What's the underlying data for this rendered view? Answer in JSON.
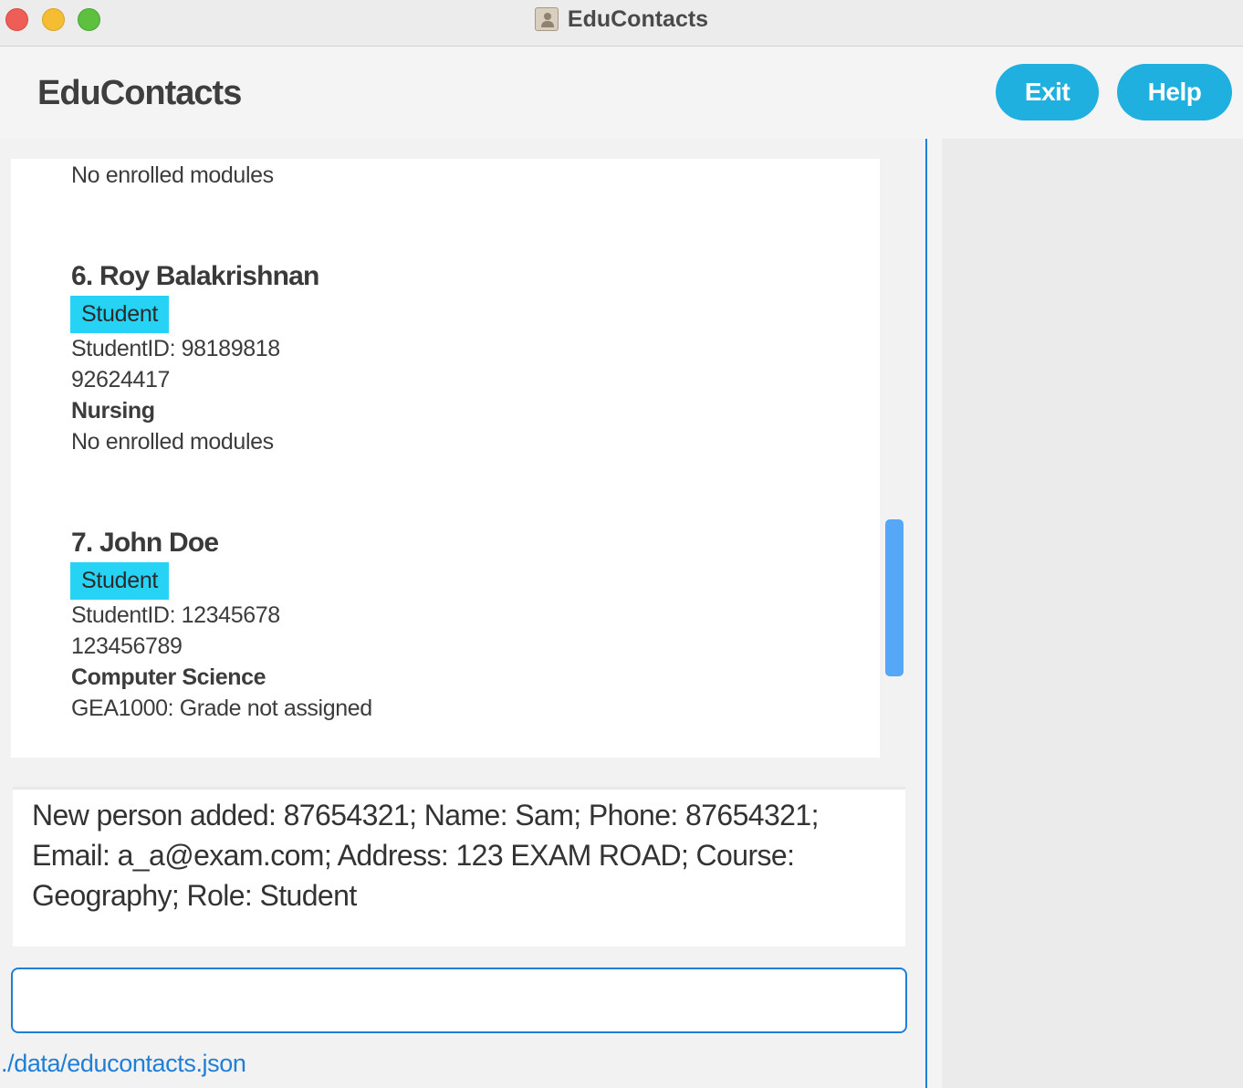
{
  "window": {
    "title": "EduContacts",
    "app_icon": "contacts-book-icon"
  },
  "header": {
    "title": "EduContacts",
    "exit_label": "Exit",
    "help_label": "Help",
    "accent_color": "#1fb0df"
  },
  "person_list": {
    "partial_top": {
      "modules": "No enrolled modules"
    },
    "people": [
      {
        "name": "6. Roy Balakrishnan",
        "role": "Student",
        "student_id": "StudentID: 98189818",
        "phone": "92624417",
        "course": "Nursing",
        "modules": "No enrolled modules"
      },
      {
        "name": "7. John Doe",
        "role": "Student",
        "student_id": "StudentID: 12345678",
        "phone": "123456789",
        "course": "Computer Science",
        "modules": "GEA1000: Grade not assigned"
      }
    ]
  },
  "result_display": {
    "text": "New person added: 87654321; Name: Sam; Phone: 87654321; Email: a_a@exam.com; Address: 123 EXAM ROAD; Course: Geography; Role: Student"
  },
  "command_box": {
    "value": ""
  },
  "status_bar": {
    "file_path": "./data/educontacts.json"
  },
  "colors": {
    "tag_background": "#26d3f5",
    "border_accent": "#1f7fd6",
    "scrollbar": "#56a7f8"
  }
}
